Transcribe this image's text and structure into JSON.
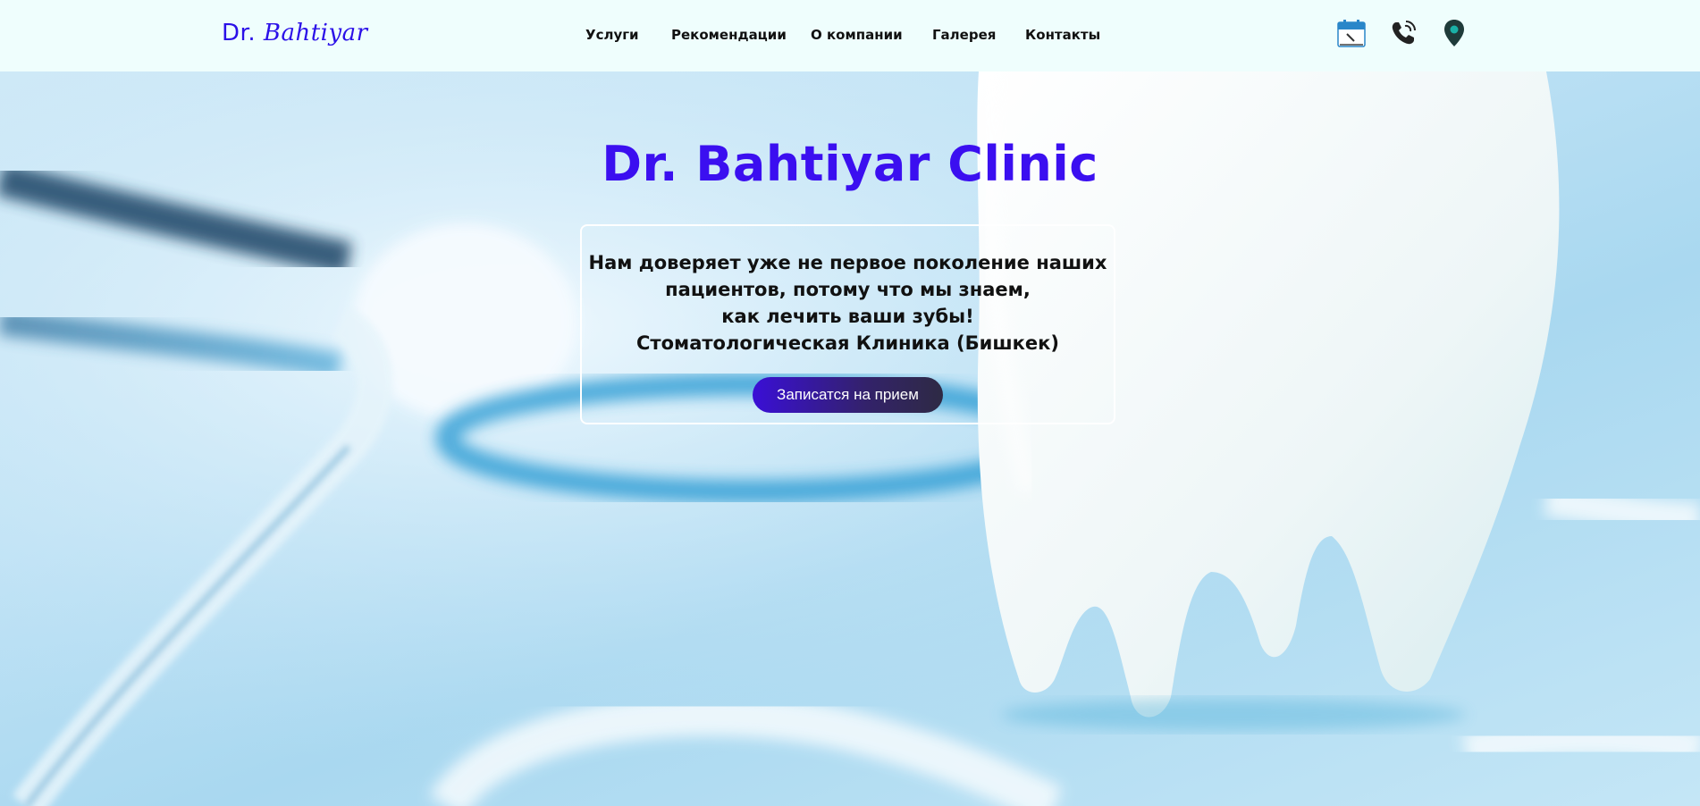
{
  "header": {
    "logo_prefix": "Dr. ",
    "logo_script": "Bahtiyar",
    "nav": [
      "Услуги",
      "Рекомендации",
      "О компании",
      "Галерея",
      "Контакты"
    ],
    "icons": [
      "calendar-icon",
      "phone-icon",
      "location-pin-icon"
    ]
  },
  "hero": {
    "title": "Dr. Bahtiyar Clinic",
    "lines": [
      "Нам доверяет уже не первое поколение наших",
      "пациентов, потому что мы знаем,",
      "как лечить ваши зубы!",
      "Стоматологическая Клиника (Бишкек)"
    ],
    "button": "Записатся на прием"
  },
  "colors": {
    "brand": "#3b0ff0",
    "nav_bg": "#effefd",
    "button_start": "#3a0fd6",
    "button_end": "#2e2a44"
  }
}
